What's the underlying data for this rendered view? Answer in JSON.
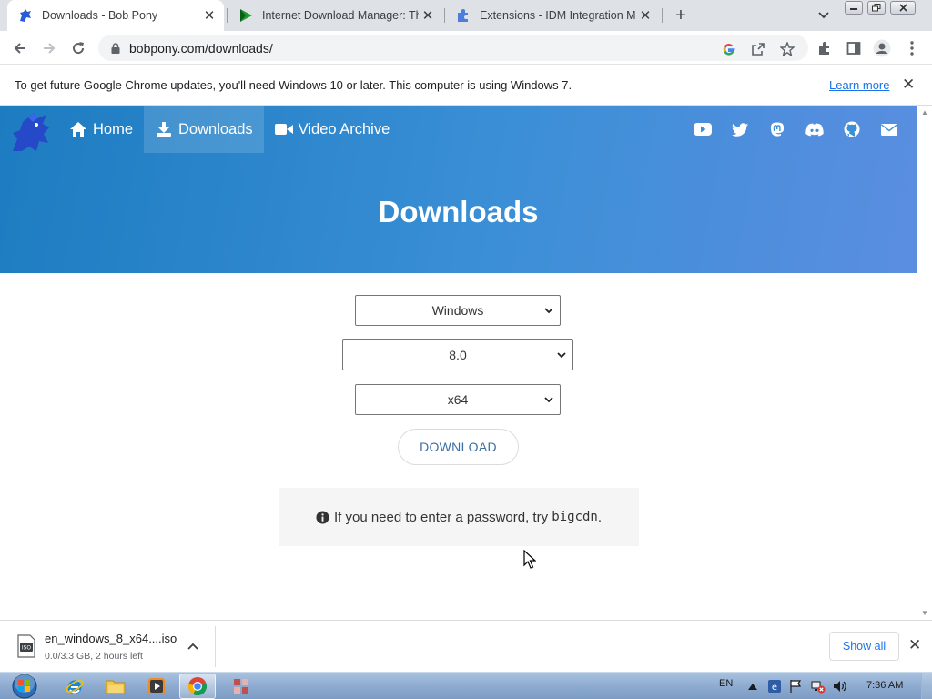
{
  "browser": {
    "tabs": [
      {
        "title": "Downloads - Bob Pony",
        "favicon": "bob-pony-icon",
        "active": true
      },
      {
        "title": "Internet Download Manager: The",
        "favicon": "idm-play-icon",
        "active": false
      },
      {
        "title": "Extensions - IDM Integration Mo",
        "favicon": "puzzle-icon",
        "active": false
      }
    ],
    "url": "bobpony.com/downloads/",
    "infobar": {
      "message": "To get future Google Chrome updates, you'll need Windows 10 or later. This computer is using Windows 7.",
      "link": "Learn more"
    }
  },
  "site": {
    "nav": [
      {
        "label": "Home",
        "icon": "home-icon"
      },
      {
        "label": "Downloads",
        "icon": "download-icon",
        "active": true
      },
      {
        "label": "Video Archive",
        "icon": "video-camera-icon"
      }
    ],
    "socials": [
      "youtube-icon",
      "twitter-icon",
      "mastodon-icon",
      "discord-icon",
      "github-icon",
      "email-icon"
    ],
    "hero_title": "Downloads",
    "selectors": {
      "os": "Windows",
      "version": "8.0",
      "arch": "x64"
    },
    "download_button": "DOWNLOAD",
    "note": {
      "text": "If you need to enter a password, try",
      "code": "bigcdn",
      "suffix": "."
    }
  },
  "download_shelf": {
    "file_name": "en_windows_8_x64....iso",
    "status": "0.0/3.3 GB, 2 hours left",
    "show_all": "Show all"
  },
  "taskbar": {
    "language": "EN",
    "time": "7:36 AM"
  },
  "colors": {
    "hero_start": "#1d7cc1",
    "hero_end": "#5b8ee0",
    "link": "#1a73e8",
    "download_button_text": "#3a6ea5"
  }
}
